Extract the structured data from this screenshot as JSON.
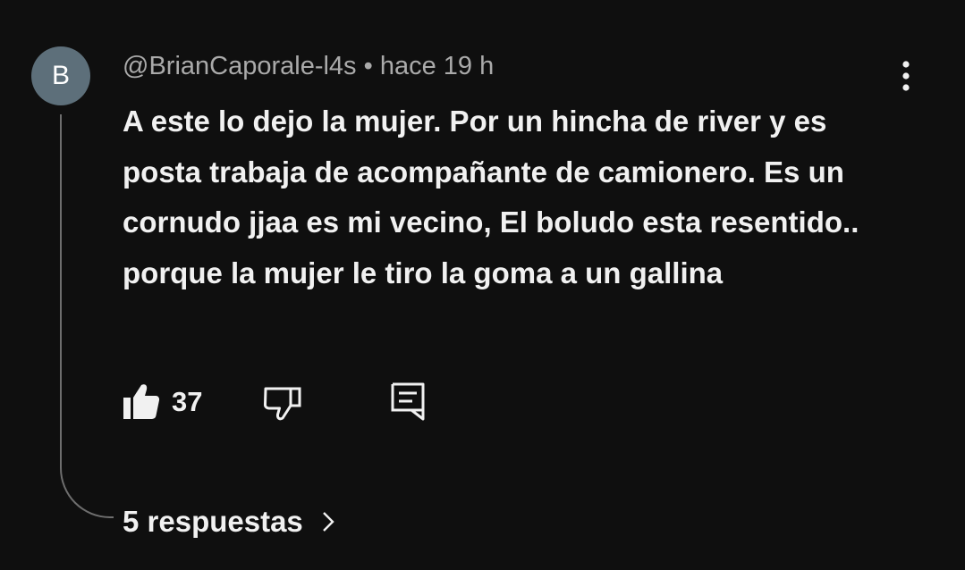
{
  "comment": {
    "avatar_letter": "B",
    "author": "@BrianCaporale-l4s",
    "separator": "•",
    "timestamp": "hace 19 h",
    "text": "A este lo dejo la mujer. Por un hincha de river y es posta trabaja de acompañante de camionero. Es un cornudo jjaa es mi vecino, El boludo esta resentido.. porque la mujer le tiro la goma a un gallina",
    "like_count": "37",
    "replies_label": "5 respuestas"
  },
  "icons": {
    "like": "thumbs-up-icon",
    "dislike": "thumbs-down-icon",
    "reply": "comment-reply-icon",
    "more": "more-vert-icon",
    "chevron": "chevron-right-icon"
  },
  "colors": {
    "background": "#0f0f0f",
    "text_primary": "#f1f1f1",
    "text_secondary": "#aaaaaa",
    "avatar_bg": "#5d6f7a",
    "thread_line": "#6e6e6e"
  }
}
